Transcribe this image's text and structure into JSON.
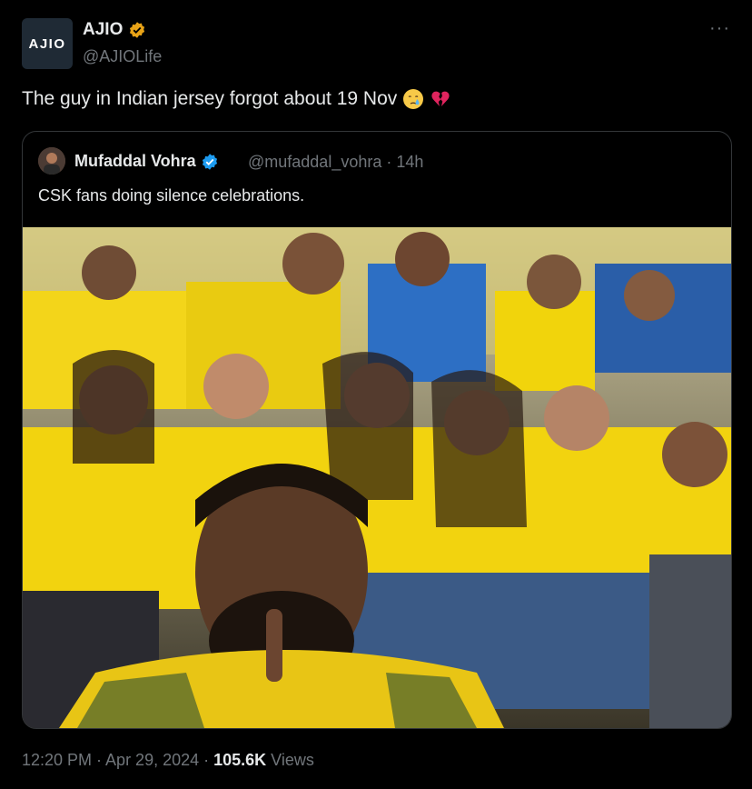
{
  "tweet": {
    "avatar_text": "AJIO",
    "author_name": "AJIO",
    "handle": "@AJIOLife",
    "more_label": "···",
    "text": "The guy in Indian jersey forgot about 19 Nov",
    "emojis": [
      "crying-face-emoji",
      "broken-heart-emoji"
    ]
  },
  "quote": {
    "author_name": "Mufaddal Vohra",
    "handle_time": "@mufaddal_vohra · 14h",
    "text": "CSK fans doing silence celebrations."
  },
  "footer": {
    "time_date": "12:20 PM · Apr 29, 2024 · ",
    "views_count": "105.6K",
    "views_label": " Views"
  },
  "colors": {
    "background": "#000000",
    "text_primary": "#e7e9ea",
    "text_secondary": "#71767b",
    "verified_gold": "#e8a317",
    "verified_blue": "#1d9bf0",
    "jersey_yellow": "#f5d90a"
  }
}
